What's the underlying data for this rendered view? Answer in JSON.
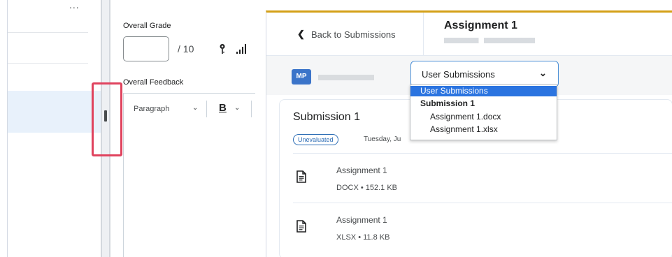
{
  "left_panel": {
    "more_menu": "...",
    "overall_grade_label": "Overall Grade",
    "grade_value": "",
    "grade_max": "/ 10",
    "overall_feedback_label": "Overall Feedback",
    "editor": {
      "paragraph_format": "Paragraph",
      "bold_label": "B"
    }
  },
  "header": {
    "back_label": "Back to Submissions",
    "assignment_title": "Assignment 1"
  },
  "student": {
    "avatar_initials": "MP",
    "select_value": "User Submissions"
  },
  "dropdown": {
    "options": [
      {
        "label": "User Submissions",
        "selected": true
      },
      {
        "label": "Submission 1",
        "group": true
      },
      {
        "label": "Assignment 1.docx"
      },
      {
        "label": "Assignment 1.xlsx"
      }
    ]
  },
  "submission": {
    "title": "Submission 1",
    "status_badge": "Unevaluated",
    "date_text": "Tuesday, Ju",
    "files": [
      {
        "name": "Assignment 1",
        "type": "DOCX",
        "size": "152.1 KB"
      },
      {
        "name": "Assignment 1",
        "type": "XLSX",
        "size": "11.8 KB"
      }
    ]
  },
  "colors": {
    "accent_border": "#d4a017",
    "highlight": "#e0435e",
    "avatar_bg": "#3b74c9",
    "selected_option": "#2b74e0",
    "badge": "#2d6db5"
  }
}
